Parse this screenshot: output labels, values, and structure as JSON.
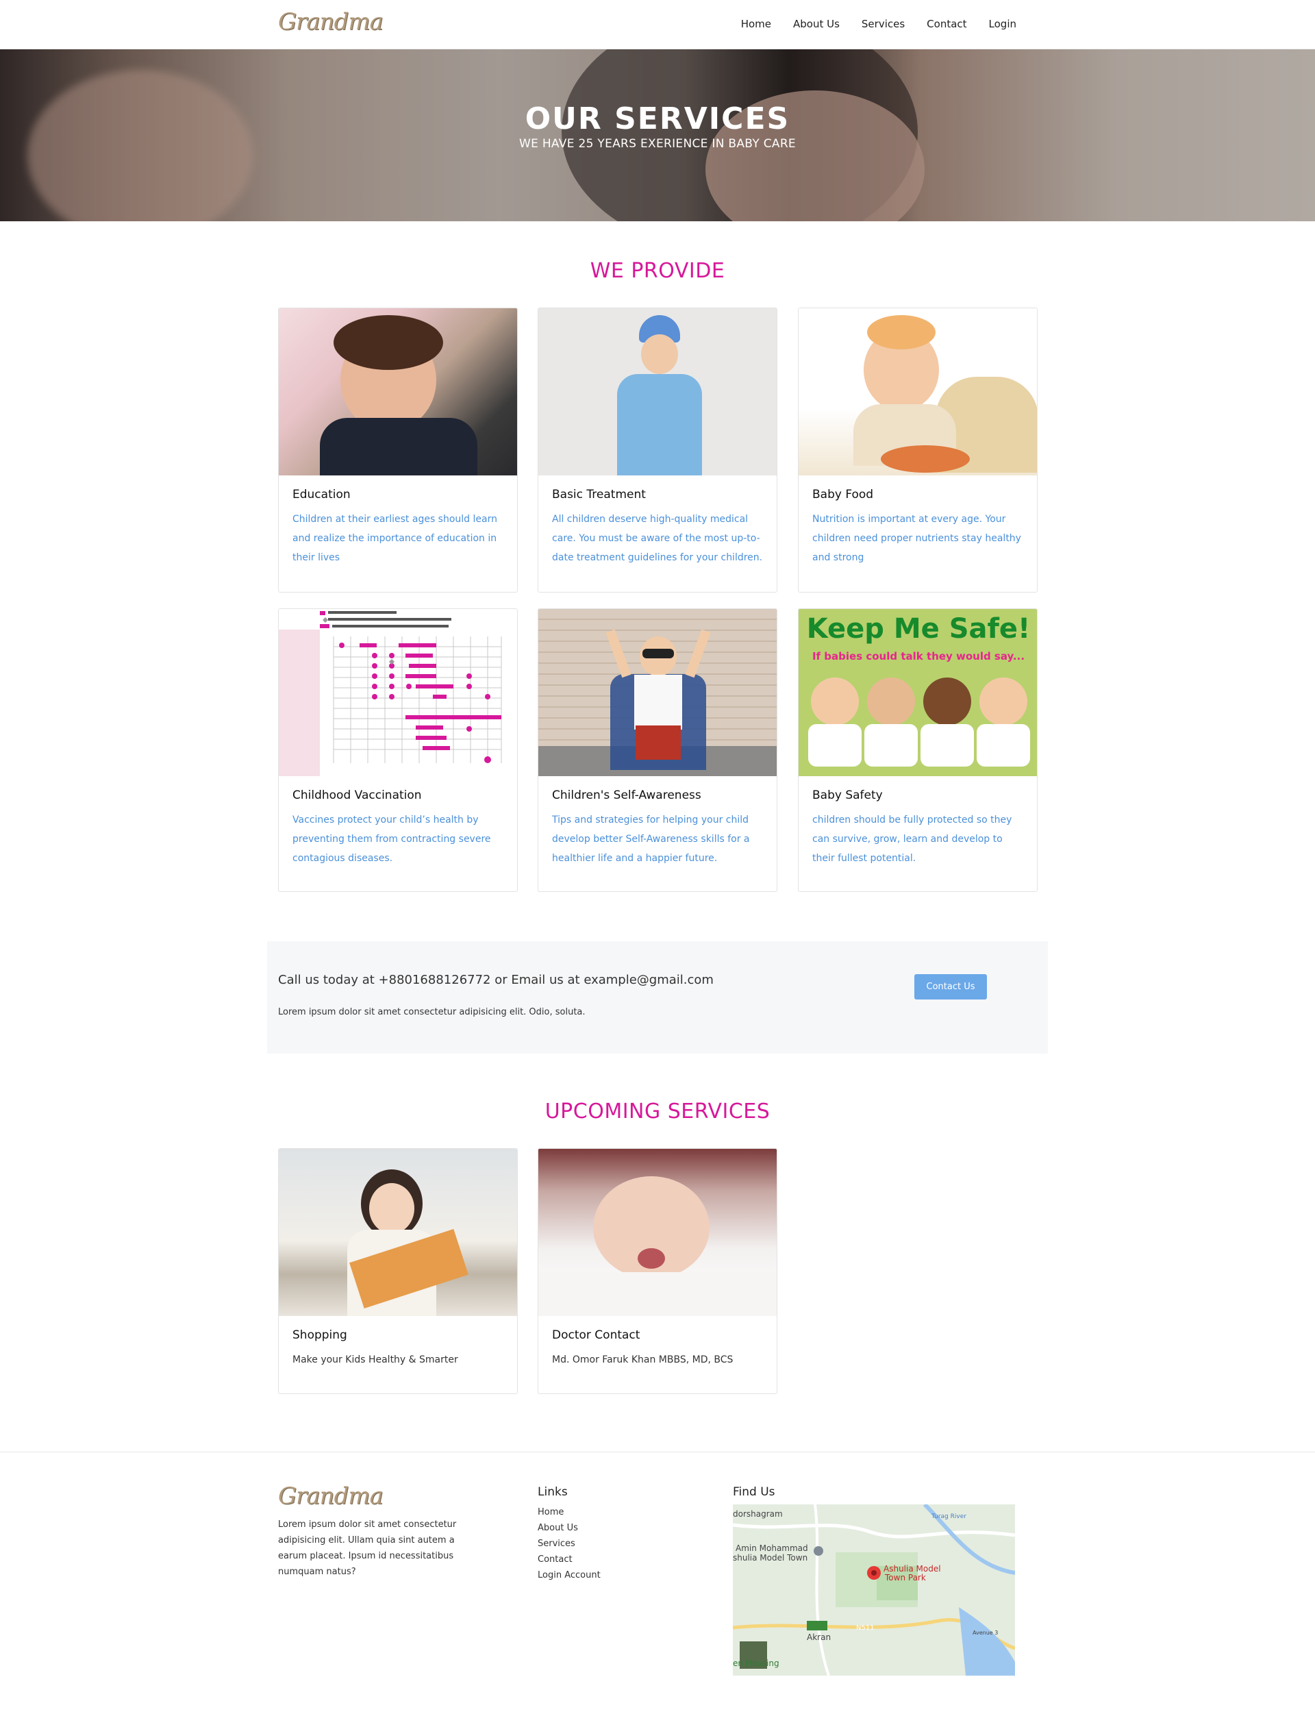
{
  "brand": {
    "logo_text": "Grandma"
  },
  "nav": {
    "items": [
      "Home",
      "About Us",
      "Services",
      "Contact",
      "Login"
    ]
  },
  "hero": {
    "title": "OUR  SERVICES",
    "subtitle": "WE HAVE 25 YEARS EXERIENCE IN BABY CARE"
  },
  "provide": {
    "heading": "WE PROVIDE",
    "cards": [
      {
        "title": "Education",
        "text": "Children at their earliest ages should learn and realize the importance of education in their lives"
      },
      {
        "title": "Basic Treatment",
        "text": "All children deserve high-quality medical care. You must be aware of the most up-to-date treatment guidelines for your children."
      },
      {
        "title": "Baby Food",
        "text": "Nutrition is important at every age. Your children need proper nutrients stay healthy and strong"
      },
      {
        "title": "Childhood Vaccination",
        "text": "Vaccines protect your child’s health by preventing them from contracting severe contagious diseases."
      },
      {
        "title": "Children's Self-Awareness",
        "text": "Tips and strategies for helping your child develop better Self-Awareness skills for a healthier life and a happier future."
      },
      {
        "title": "Baby Safety",
        "text": "children should be fully protected so they can survive, grow, learn and develop to their fullest potential."
      }
    ]
  },
  "safety_image": {
    "headline": "Keep Me Safe!",
    "subline": "If babies could talk they would say..."
  },
  "contact": {
    "main": "Call us today at +8801688126772 or Email us at example@gmail.com",
    "small": "Lorem ipsum dolor sit amet consectetur adipisicing elit. Odio, soluta.",
    "button": "Contact Us"
  },
  "upcoming": {
    "heading": "UPCOMING SERVICES",
    "cards": [
      {
        "title": "Shopping",
        "text": "Make your Kids Healthy & Smarter"
      },
      {
        "title": "Doctor Contact",
        "text": "Md. Omor Faruk Khan MBBS, MD, BCS"
      }
    ]
  },
  "footer": {
    "logo_text": "Grandma",
    "about": "Lorem ipsum dolor sit amet consectetur adipisicing elit. Ullam quia sint autem a earum placeat. Ipsum id necessitatibus numquam natus?",
    "links_heading": "Links",
    "links": [
      "Home",
      "About Us",
      "Services",
      "Contact",
      "Login Account"
    ],
    "find_heading": "Find Us",
    "map_labels": [
      "dorshagram",
      "Amin Mohammad",
      "shulia Model Town",
      "Ashulia Model",
      "Town Park",
      "N511",
      "Akran",
      "Avenue 3",
      "Turag River",
      "en Housing"
    ]
  }
}
